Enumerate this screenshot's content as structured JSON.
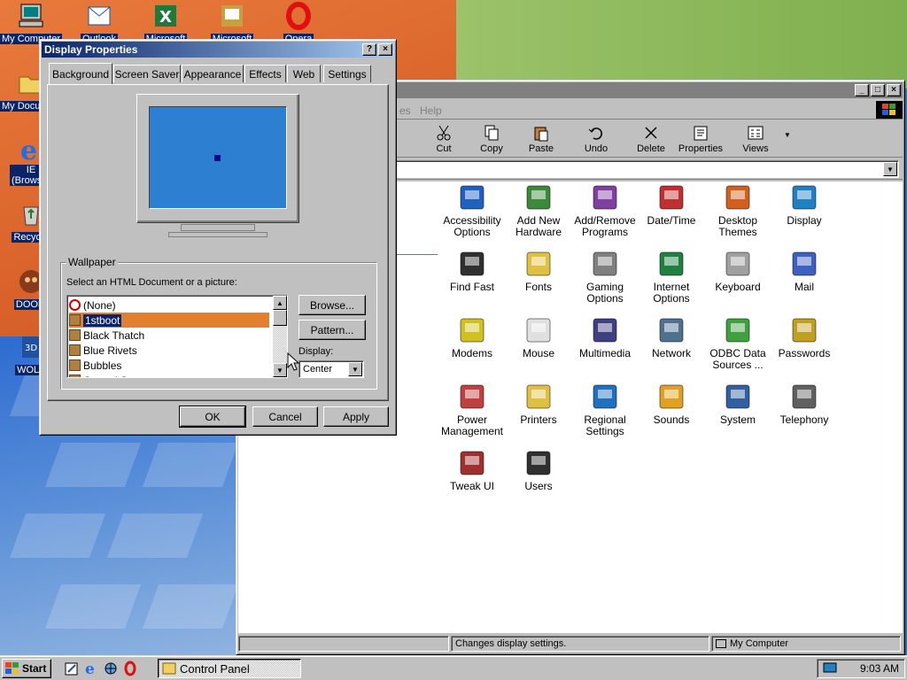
{
  "desktop": {
    "icons": [
      {
        "label": "My Computer",
        "icon": "computer-icon"
      },
      {
        "label": "My Documents",
        "icon": "folder-icon"
      },
      {
        "label": "IE (Browser)",
        "icon": "ie-icon"
      },
      {
        "label": "Recycle",
        "icon": "recycle-bin-icon"
      },
      {
        "label": "DOOM",
        "icon": "doom-icon"
      },
      {
        "label": "WOLF",
        "icon": "wolf-icon"
      }
    ],
    "top_icons": [
      {
        "label": "Outlook",
        "icon": "outlook-icon"
      },
      {
        "label": "Microsoft",
        "icon": "excel-icon"
      },
      {
        "label": "Microsoft",
        "icon": "ppt-icon"
      },
      {
        "label": "Opera",
        "icon": "opera-icon"
      }
    ]
  },
  "control_panel": {
    "menu_items": [
      "es",
      "Help"
    ],
    "toolbar": [
      {
        "label": "Cut",
        "icon": "scissors-icon"
      },
      {
        "label": "Copy",
        "icon": "copy-icon"
      },
      {
        "label": "Paste",
        "icon": "paste-icon"
      },
      {
        "label": "Undo",
        "icon": "undo-icon"
      },
      {
        "label": "Delete",
        "icon": "delete-icon"
      },
      {
        "label": "Properties",
        "icon": "properties-icon"
      },
      {
        "label": "Views",
        "icon": "views-icon"
      }
    ],
    "items": [
      {
        "label": "Accessibility Options",
        "icon": "accessibility-icon",
        "color": "#2060c0"
      },
      {
        "label": "Add New Hardware",
        "icon": "hardware-icon",
        "color": "#3a8a3a"
      },
      {
        "label": "Add/Remove Programs",
        "icon": "programs-icon",
        "color": "#8040a0"
      },
      {
        "label": "Date/Time",
        "icon": "clock-icon",
        "color": "#c03030"
      },
      {
        "label": "Desktop Themes",
        "icon": "themes-icon",
        "color": "#d06020"
      },
      {
        "label": "Display",
        "icon": "display-icon",
        "color": "#2080c0"
      },
      {
        "label": "Find Fast",
        "icon": "binoculars-icon",
        "color": "#303030"
      },
      {
        "label": "Fonts",
        "icon": "fonts-folder-icon",
        "color": "#e0c040"
      },
      {
        "label": "Gaming Options",
        "icon": "joystick-icon",
        "color": "#808080"
      },
      {
        "label": "Internet Options",
        "icon": "globe-icon",
        "color": "#208040"
      },
      {
        "label": "Keyboard",
        "icon": "keyboard-icon",
        "color": "#a0a0a0"
      },
      {
        "label": "Mail",
        "icon": "mail-icon",
        "color": "#4060c0"
      },
      {
        "label": "Modems",
        "icon": "modem-icon",
        "color": "#d0c020"
      },
      {
        "label": "Mouse",
        "icon": "mouse-icon",
        "color": "#e0e0e0"
      },
      {
        "label": "Multimedia",
        "icon": "multimedia-icon",
        "color": "#404080"
      },
      {
        "label": "Network",
        "icon": "network-icon",
        "color": "#507090"
      },
      {
        "label": "ODBC Data Sources ...",
        "icon": "odbc-icon",
        "color": "#40a040"
      },
      {
        "label": "Passwords",
        "icon": "keys-icon",
        "color": "#c0a020"
      },
      {
        "label": "Power Management",
        "icon": "power-icon",
        "color": "#c04040"
      },
      {
        "label": "Printers",
        "icon": "printer-folder-icon",
        "color": "#e0c040"
      },
      {
        "label": "Regional Settings",
        "icon": "globe-icon",
        "color": "#2070c0"
      },
      {
        "label": "Sounds",
        "icon": "speaker-icon",
        "color": "#e0a020"
      },
      {
        "label": "System",
        "icon": "system-icon",
        "color": "#3060a0"
      },
      {
        "label": "Telephony",
        "icon": "phone-icon",
        "color": "#606060"
      },
      {
        "label": "Tweak UI",
        "icon": "tweakui-icon",
        "color": "#a03030"
      },
      {
        "label": "Users",
        "icon": "users-icon",
        "color": "#303030"
      }
    ],
    "status_left": "Changes display settings.",
    "status_right": "My Computer"
  },
  "display_props": {
    "title": "Display Properties",
    "tabs": [
      "Background",
      "Screen Saver",
      "Appearance",
      "Effects",
      "Web",
      "Settings"
    ],
    "wallpaper_group": "Wallpaper",
    "wallpaper_prompt": "Select an HTML Document or a picture:",
    "wallpapers": [
      "(None)",
      "1stboot",
      "Black Thatch",
      "Blue Rivets",
      "Bubbles",
      "Carved Stone"
    ],
    "selected_wallpaper": "1stboot",
    "browse_label": "Browse...",
    "pattern_label": "Pattern...",
    "display_label": "Display:",
    "display_value": "Center",
    "ok_label": "OK",
    "cancel_label": "Cancel",
    "apply_label": "Apply",
    "help_label": "?",
    "close_label": "×"
  },
  "taskbar": {
    "start_label": "Start",
    "task_label": "Control Panel",
    "clock": "9:03 AM"
  }
}
